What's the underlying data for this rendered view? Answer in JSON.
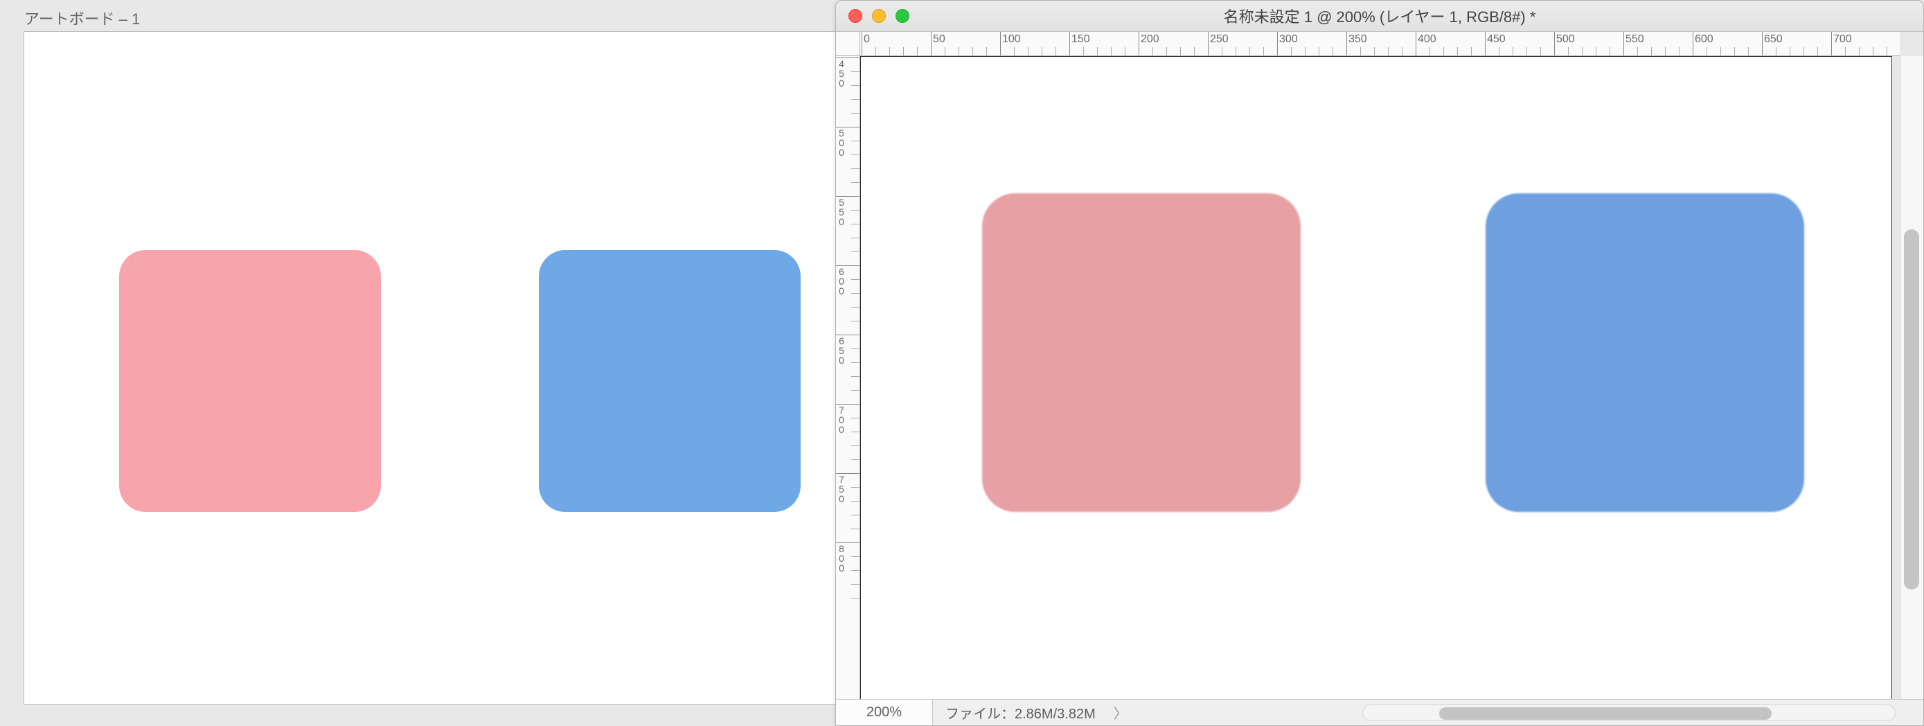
{
  "left": {
    "artboard_label": "アートボード – 1",
    "shapes": {
      "pink_color": "#f7a4ac",
      "blue_color": "#6ea8e6"
    }
  },
  "right": {
    "title": "名称未設定 1 @ 200% (レイヤー 1, RGB/8#) *",
    "traffic": {
      "close": "close",
      "minimize": "minimize",
      "maximize": "maximize"
    },
    "ruler_h_ticks": [
      "0",
      "50",
      "100",
      "150",
      "200",
      "250",
      "300",
      "350",
      "400",
      "450",
      "500",
      "550",
      "600",
      "650",
      "700"
    ],
    "ruler_v_ticks": [
      "450",
      "500",
      "550",
      "600",
      "650",
      "700",
      "750",
      "800"
    ],
    "status": {
      "zoom": "200%",
      "file_label": "ファイル：2.86M/3.82M"
    },
    "shapes": {
      "pink_color": "#e7a0a4",
      "blue_color": "#6e9fe1"
    }
  }
}
